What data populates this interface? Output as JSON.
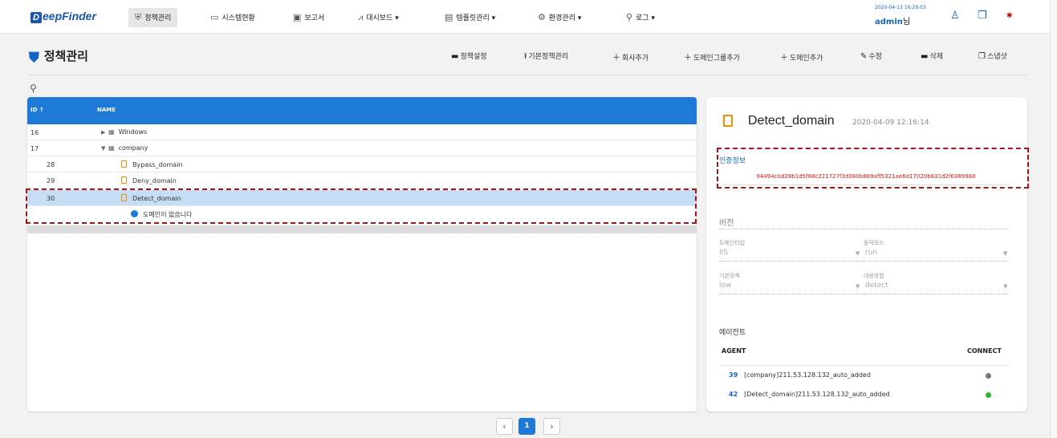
{
  "brand": {
    "letter": "D",
    "name": "eepFinder"
  },
  "nav": {
    "items": [
      {
        "icon": "shield-icon",
        "glyph": "⛨",
        "label": "정책관리"
      },
      {
        "icon": "monitor-icon",
        "glyph": "▭",
        "label": "시스템현황"
      },
      {
        "icon": "clipboard-icon",
        "glyph": "▣",
        "label": "보고서"
      },
      {
        "icon": "trend-icon",
        "glyph": "⩘",
        "label": "대시보드 ▾"
      },
      {
        "icon": "template-icon",
        "glyph": "▤",
        "label": "템플릿관리 ▾"
      },
      {
        "icon": "gear-icon",
        "glyph": "⚙",
        "label": "환경관리 ▾"
      },
      {
        "icon": "search-icon",
        "glyph": "⚲",
        "label": "로그 ▾"
      }
    ],
    "datetime": "2020-04-13 16:29:03",
    "user": "admin",
    "user_suffix": "님"
  },
  "page": {
    "title": "정책관리",
    "toolbar": [
      {
        "icon": "folder-icon",
        "glyph": "▬",
        "label": "정책설정"
      },
      {
        "icon": "upload-icon",
        "glyph": "⭱",
        "label": "기본정책관리"
      },
      {
        "icon": "plus-icon",
        "glyph": "＋",
        "label": "회사추가"
      },
      {
        "icon": "plus-icon",
        "glyph": "＋",
        "label": "도메인그룹추가"
      },
      {
        "icon": "plus-icon",
        "glyph": "＋",
        "label": "도메인추가"
      },
      {
        "icon": "pencil-icon",
        "glyph": "✎",
        "label": "수정"
      },
      {
        "icon": "minus-icon",
        "glyph": "▬",
        "label": "삭제"
      },
      {
        "icon": "copy-icon",
        "glyph": "❐",
        "label": "스냅샷"
      }
    ]
  },
  "grid": {
    "col_id": "ID ↑",
    "col_name": "NAME",
    "rows": [
      {
        "id": "16",
        "name": "Windows"
      },
      {
        "id": "17",
        "name": "company"
      },
      {
        "id": "28",
        "name": "Bypass_domain"
      },
      {
        "id": "29",
        "name": "Deny_domain"
      },
      {
        "id": "30",
        "name": "Detect_domain"
      }
    ],
    "empty_msg": "도메인이 없습니다",
    "pager": {
      "prev": "‹",
      "page": "1",
      "next": "›"
    }
  },
  "detail": {
    "title": "Detect_domain",
    "date": "2020-04-09 12:16:14",
    "auth_label": "인증정보",
    "hash": "94494c0d28b1d5f88c221727f3d380b889aff5321ae6d17020b631d2f6389980",
    "version_label": "버전",
    "domain_type_label": "도메인타입",
    "domain_type_value": "IIS",
    "run_mode_label": "동작모드",
    "run_mode_value": "run",
    "base_policy_label": "기본정책",
    "base_policy_value": "low",
    "response_label": "대응방법",
    "response_value": "detect",
    "agents_title": "에이전트",
    "col_agent": "AGENT",
    "col_connect": "CONNECT",
    "agents": [
      {
        "id": "39",
        "name": "[company]211.53.128.132_auto_added",
        "status_color": "#777777"
      },
      {
        "id": "42",
        "name": "[Detect_domain]211.53.128.132_auto_added",
        "status_color": "#2db82d"
      }
    ]
  }
}
